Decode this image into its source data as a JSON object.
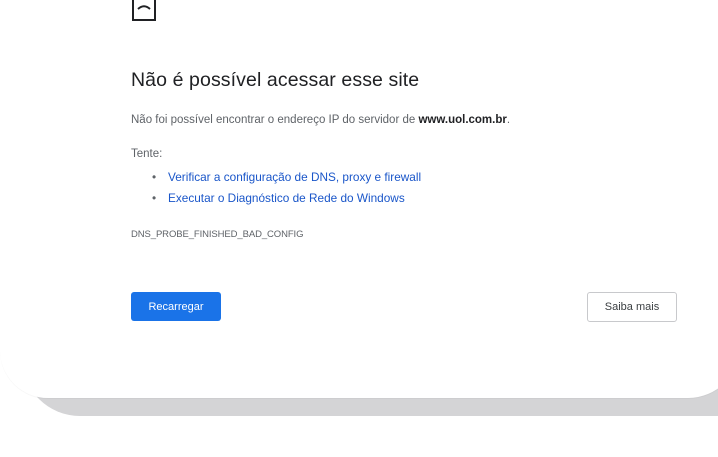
{
  "error_page": {
    "title": "Não é possível acessar esse site",
    "description_prefix": "Não foi possível encontrar o endereço IP do servidor de ",
    "domain": "www.uol.com.br",
    "description_suffix": ".",
    "try_label": "Tente:",
    "suggestions": [
      {
        "label": "Verificar a configuração de DNS, proxy e firewall"
      },
      {
        "label": "Executar o Diagnóstico de Rede do Windows"
      }
    ],
    "error_code": "DNS_PROBE_FINISHED_BAD_CONFIG",
    "icon": "sad-page-icon"
  },
  "buttons": {
    "reload_label": "Recarregar",
    "learn_more_label": "Saiba mais"
  },
  "colors": {
    "primary_button": "#1a73e8",
    "link": "#1a56c9",
    "title_text": "#202124",
    "body_text": "#5f6368",
    "frame_shadow": "#d4d4d6"
  }
}
